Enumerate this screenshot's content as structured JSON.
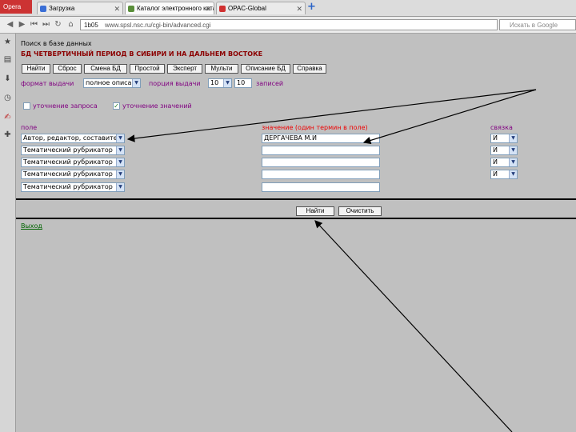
{
  "browser": {
    "menu_label": "Opera",
    "tabs": [
      {
        "label": "Загрузка"
      },
      {
        "label": "Каталог электронного каталога"
      },
      {
        "label": "OPAC-Global"
      }
    ],
    "address": {
      "site": "1b05",
      "url": "www.spsl.nsc.ru/cgi-bin/advanced.cgi"
    },
    "search_placeholder": "Искать в Google"
  },
  "page": {
    "breadcrumb": "Поиск в базе данных",
    "db_title": "БД ЧЕТВЕРТИЧНЫЙ ПЕРИОД В СИБИРИ И НА ДАЛЬНЕМ ВОСТОКЕ",
    "toolbar": [
      "Найти",
      "Сброс",
      "Смена БД",
      "Простой",
      "Эксперт",
      "Мульти",
      "Описание БД",
      "Справка"
    ],
    "format_label": "формат выдачи",
    "format_value": "полное описание",
    "order_label": "порция выдачи",
    "order_value": "10",
    "count_value": "10",
    "records_label": "записей",
    "refine_query_label": "уточнение запроса",
    "refine_values_label": "уточнение значений",
    "refine_query_checked": false,
    "refine_values_checked": true,
    "col_field": "поле",
    "col_value": "значение (один термин в поле)",
    "col_link": "связка",
    "rows": [
      {
        "field": "Автор, редактор, составитель",
        "value": "ДЕРГАЧЕВА М.И",
        "link": "И"
      },
      {
        "field": "Тематический рубрикатор",
        "value": "",
        "link": "И"
      },
      {
        "field": "Тематический рубрикатор",
        "value": "",
        "link": "И"
      },
      {
        "field": "Тематический рубрикатор",
        "value": "",
        "link": "И"
      },
      {
        "field": "Тематический рубрикатор",
        "value": "",
        "link": ""
      }
    ],
    "find_button": "Найти",
    "clear_button": "Очистить",
    "back_link": "Выход"
  }
}
